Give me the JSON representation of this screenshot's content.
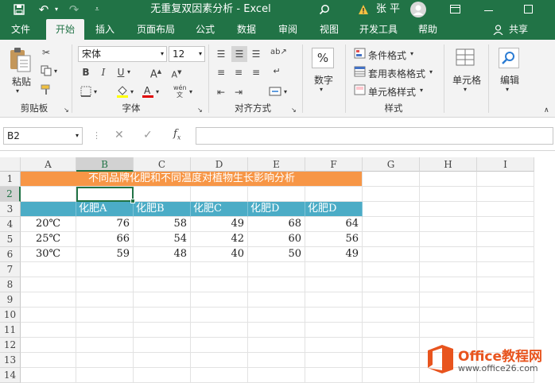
{
  "window": {
    "title": "无重复双因素分析 - Excel",
    "user": "张 平"
  },
  "tabs": [
    "文件",
    "开始",
    "插入",
    "页面布局",
    "公式",
    "数据",
    "审阅",
    "视图",
    "开发工具",
    "帮助"
  ],
  "share_label": "共享",
  "ribbon": {
    "paste_label": "粘贴",
    "font_name": "宋体",
    "font_size": "12",
    "number_label": "数字",
    "cond_format": "条件格式",
    "table_format": "套用表格格式",
    "cell_style": "单元格样式",
    "cells_label": "单元格",
    "edit_label": "编辑",
    "groups": {
      "clipboard": "剪贴板",
      "font": "字体",
      "align": "对齐方式",
      "styles": "样式"
    }
  },
  "namebox": "B2",
  "columns": [
    "A",
    "B",
    "C",
    "D",
    "E",
    "F",
    "G",
    "H",
    "I"
  ],
  "rows": [
    "1",
    "2",
    "3",
    "4",
    "5",
    "6",
    "7",
    "8",
    "9",
    "10",
    "11",
    "12",
    "13",
    "14"
  ],
  "sheet": {
    "title": "不同品牌化肥和不同温度对植物生长影响分析",
    "headers": [
      "化肥A",
      "化肥B",
      "化肥C",
      "化肥D",
      "化肥D"
    ],
    "data": [
      {
        "temp": "20℃",
        "values": [
          "76",
          "58",
          "49",
          "68",
          "64"
        ]
      },
      {
        "temp": "25℃",
        "values": [
          "66",
          "54",
          "42",
          "60",
          "56"
        ]
      },
      {
        "temp": "30℃",
        "values": [
          "59",
          "48",
          "40",
          "50",
          "49"
        ]
      }
    ]
  },
  "watermark": {
    "brand": "Office教程网",
    "url": "www.office26.com"
  },
  "colors": {
    "excel_green": "#217346",
    "title_fill": "#f79646",
    "header_fill": "#4bacc6"
  }
}
